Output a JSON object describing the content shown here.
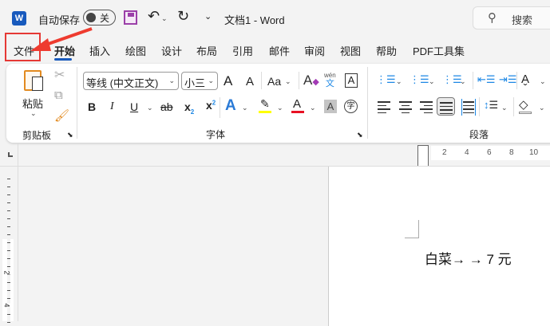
{
  "titlebar": {
    "autosave_label": "自动保存",
    "toggle_state": "关",
    "doc_title": "文档1  -  Word",
    "search_placeholder": "搜索"
  },
  "tabs": [
    "文件",
    "开始",
    "插入",
    "绘图",
    "设计",
    "布局",
    "引用",
    "邮件",
    "审阅",
    "视图",
    "帮助",
    "PDF工具集"
  ],
  "active_tab": "开始",
  "clipboard": {
    "paste_label": "粘贴",
    "group_label": "剪贴板"
  },
  "font": {
    "font_name": "等线 (中文正文)",
    "font_size": "小三",
    "group_label": "字体",
    "grow": "A",
    "shrink": "A",
    "case": "Aa",
    "bold": "B",
    "italic": "I",
    "underline": "U",
    "strike": "ab",
    "sub": "x",
    "sup": "x",
    "effects": "A",
    "fontcolor": "A",
    "shade": "A",
    "phonetic_top": "wén",
    "phonetic_bottom": "文",
    "border": "A",
    "enclose": "字",
    "highlight_color": "#ffff00",
    "font_color": "#e81123"
  },
  "paragraph": {
    "group_label": "段落"
  },
  "ruler": {
    "ticks": [
      "2",
      "4",
      "6",
      "8",
      "10"
    ],
    "vticks": [
      "2",
      "4"
    ]
  },
  "document": {
    "text": "白菜→ → 7 元"
  }
}
